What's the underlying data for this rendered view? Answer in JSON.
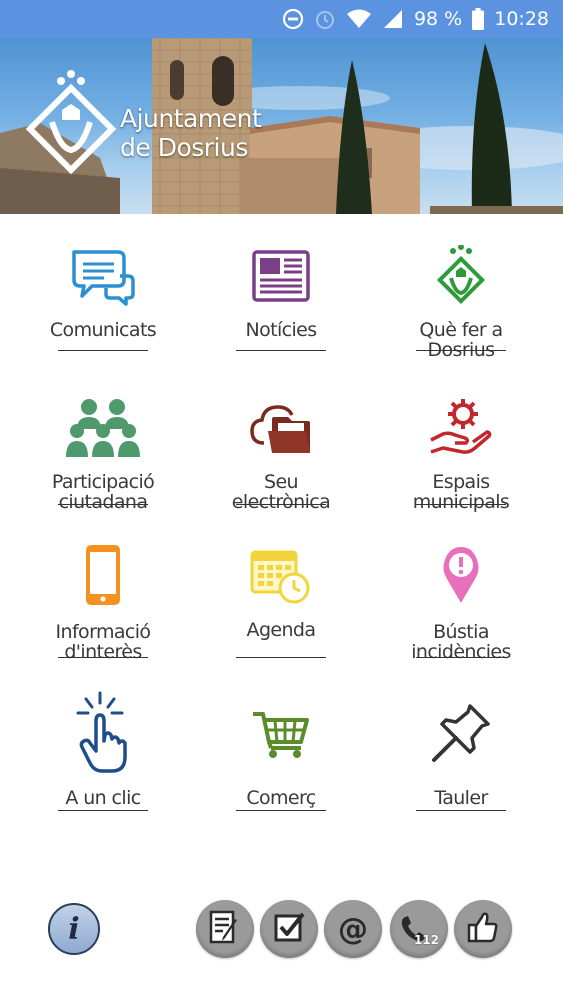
{
  "status_bar": {
    "battery": "98 %",
    "time": "10:28"
  },
  "header": {
    "brand_line1": "Ajuntament",
    "brand_line2": "de Dosrius"
  },
  "menu": [
    {
      "label": "Comunicats",
      "icon": "chat-bubbles-icon",
      "color": "#2c8fcf"
    },
    {
      "label": "Notícies",
      "icon": "newspaper-icon",
      "color": "#7a3f86"
    },
    {
      "label": "Què fer a\nDosrius",
      "icon": "town-logo-icon",
      "color": "#2e9a3c"
    },
    {
      "label": "Participació\nciutadana",
      "icon": "people-group-icon",
      "color": "#4f9a6c"
    },
    {
      "label": "Seu\nelectrònica",
      "icon": "cloud-folder-icon",
      "color": "#7b2b1e"
    },
    {
      "label": "Espais\nmunicipals",
      "icon": "hand-gear-icon",
      "color": "#c1272d"
    },
    {
      "label": "Informació\nd'interès",
      "icon": "smartphone-icon",
      "color": "#f39221"
    },
    {
      "label": "Agenda",
      "icon": "calendar-clock-icon",
      "color": "#f2d53c"
    },
    {
      "label": "Bústia\nincidències",
      "icon": "map-pin-alert-icon",
      "color": "#e76fbb"
    },
    {
      "label": "A un clic",
      "icon": "hand-click-icon",
      "color": "#1d4e89"
    },
    {
      "label": "Comerç",
      "icon": "shopping-cart-icon",
      "color": "#5a8d2a"
    },
    {
      "label": "Tauler",
      "icon": "pushpin-icon",
      "color": "#333333"
    }
  ],
  "footer": {
    "info_label": "i",
    "phone_badge": "112",
    "at_label": "@",
    "buttons": [
      "form-edit-icon",
      "checkbox-icon",
      "at-sign-icon",
      "phone-112-icon",
      "thumbs-up-icon"
    ]
  }
}
